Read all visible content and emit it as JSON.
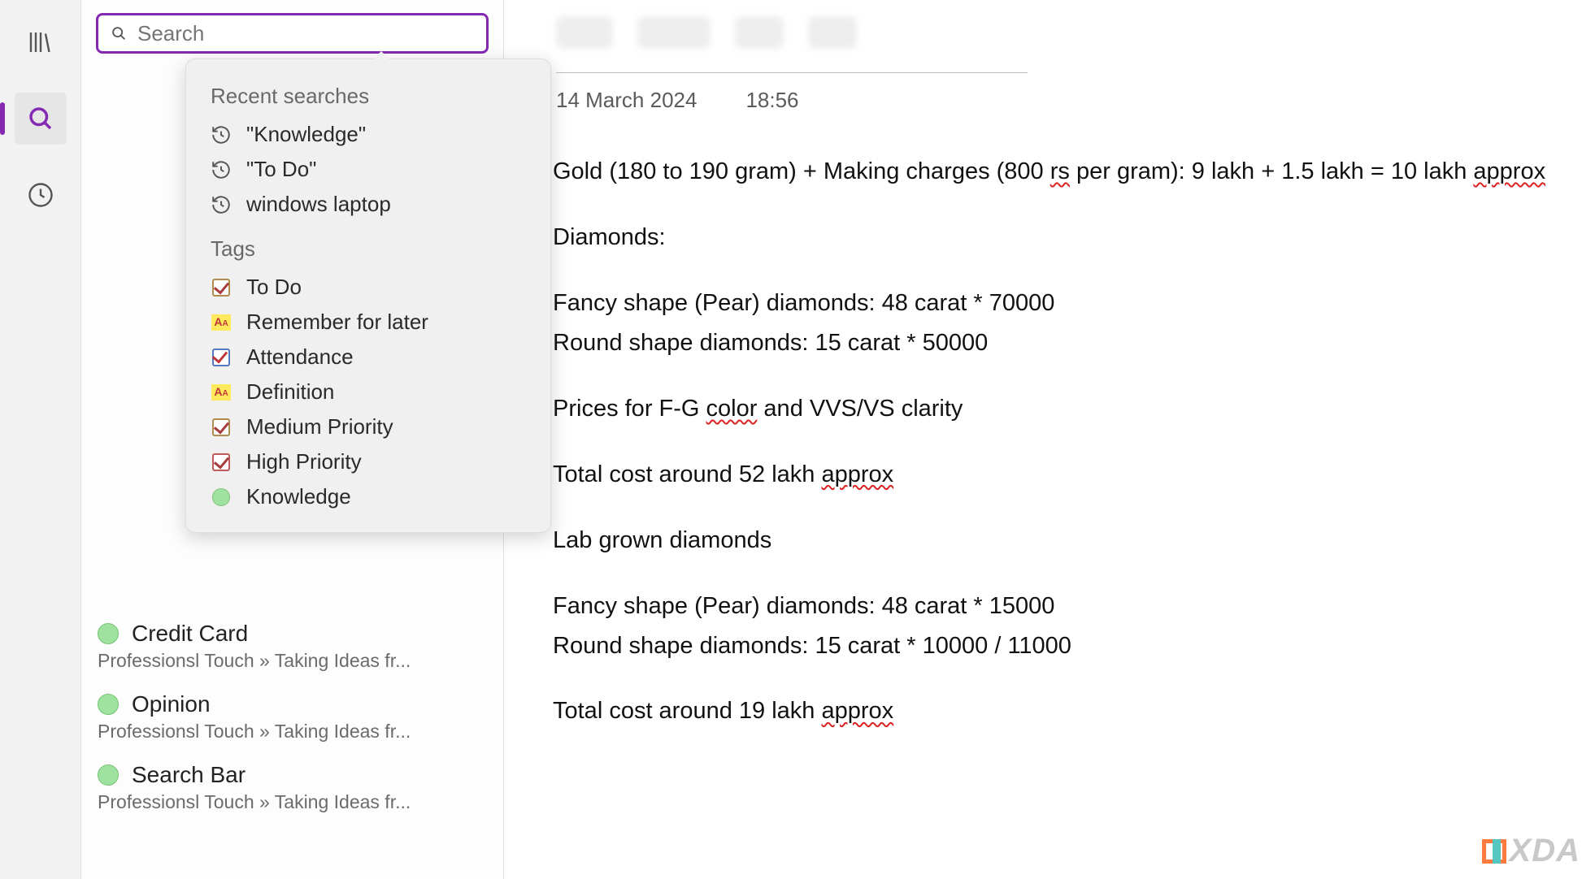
{
  "search": {
    "placeholder": "Search"
  },
  "dropdown": {
    "recent_title": "Recent searches",
    "recent": [
      "\"Knowledge\"",
      "\"To Do\"",
      "windows laptop"
    ],
    "tags_title": "Tags",
    "tags": [
      {
        "label": "To Do",
        "icon": "checkbox"
      },
      {
        "label": "Remember for later",
        "icon": "aa"
      },
      {
        "label": "Attendance",
        "icon": "graph-check"
      },
      {
        "label": "Definition",
        "icon": "aa"
      },
      {
        "label": "Medium Priority",
        "icon": "checkbox"
      },
      {
        "label": "High Priority",
        "icon": "checkbox-red"
      },
      {
        "label": "Knowledge",
        "icon": "green-dot"
      }
    ]
  },
  "notes_list": [
    {
      "title": "Credit Card",
      "path": "Professionsl Touch » Taking Ideas fr..."
    },
    {
      "title": "Opinion",
      "path": "Professionsl Touch » Taking Ideas fr..."
    },
    {
      "title": "Search Bar",
      "path": "Professionsl Touch » Taking Ideas fr..."
    }
  ],
  "note": {
    "date": "14 March 2024",
    "time": "18:56",
    "body": {
      "l1a": "Gold (180 to 190 gram) + Making charges (800 ",
      "l1_rs": "rs",
      "l1b": " per gram): 9 lakh + 1.5 lakh = 10 lakh ",
      "l1_approx": "approx",
      "l2": "Diamonds:",
      "l3": "Fancy shape (Pear) diamonds: 48 carat * 70000",
      "l4": "Round shape diamonds: 15 carat * 50000",
      "l5a": "Prices for F-G ",
      "l5_color": "color",
      "l5b": " and VVS/VS clarity",
      "l6a": "Total cost around 52 lakh ",
      "l6_approx": "approx",
      "l7": "Lab grown diamonds",
      "l8": "Fancy shape (Pear) diamonds: 48 carat * 15000",
      "l9": "Round shape diamonds: 15 carat * 10000 / 11000",
      "l10a": "Total cost around 19 lakh ",
      "l10_approx": "approx"
    }
  },
  "watermark": "XDA"
}
